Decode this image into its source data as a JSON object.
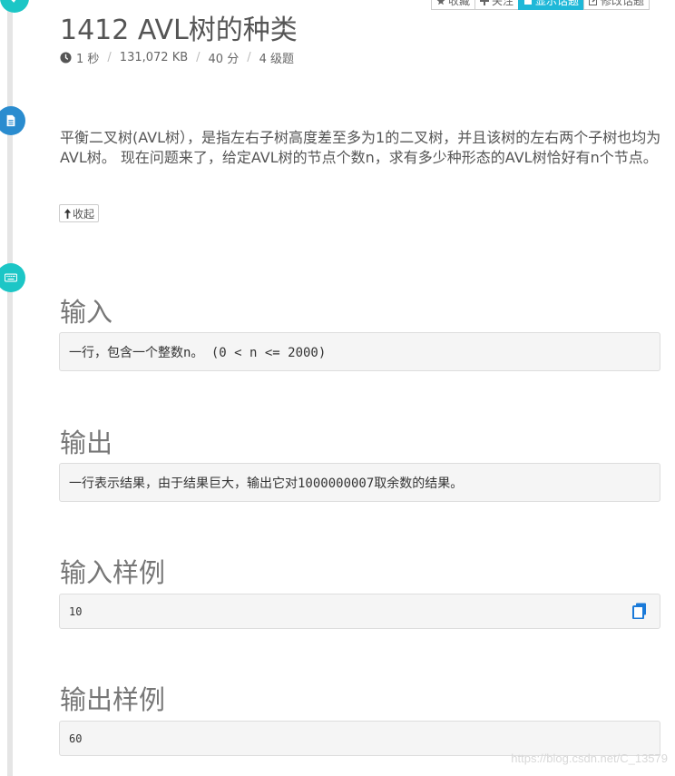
{
  "toolbar": {
    "favorite_label": "收藏",
    "follow_label": "关注",
    "show_problem_label": "显示话题",
    "edit_problem_label": "修改话题"
  },
  "problem": {
    "title": "1412 AVL树的种类",
    "time_limit": "1 秒",
    "memory_limit": "131,072 KB",
    "score": "40 分",
    "level": "4 级题",
    "description": "平衡二叉树(AVL树），是指左右子树高度差至多为1的二叉树，并且该树的左右两个子树也均为AVL树。 现在问题来了，给定AVL树的节点个数n，求有多少种形态的AVL树恰好有n个节点。",
    "collapse_label": "收起"
  },
  "sections": {
    "input_title": "输入",
    "input_text": "一行，包含一个整数n。 (0 < n <= 2000)",
    "output_title": "输出",
    "output_text": "一行表示结果，由于结果巨大，输出它对1000000007取余数的结果。",
    "sample_input_title": "输入样例",
    "sample_input": "10",
    "sample_output_title": "输出样例",
    "sample_output": "60"
  },
  "watermark": "https://blog.csdn.net/C_13579",
  "colors": {
    "accent": "#1fb8d8",
    "timeline_dot_blue": "#2a8ccf",
    "timeline_dot_teal": "#1cc6c6"
  },
  "icons": {
    "top_dot": "check-icon",
    "desc_dot": "document-icon",
    "io_dot": "keyboard-icon",
    "copy": "copy-icon"
  }
}
